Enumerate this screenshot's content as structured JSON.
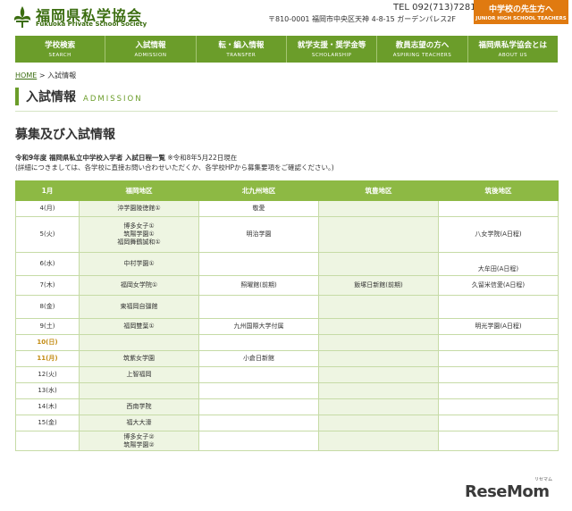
{
  "header": {
    "title": "福岡県私学協会",
    "subtitle": "Fukuoka Private School Society",
    "tel": "TEL 092(713)7281",
    "address": "〒810-0001 福岡市中央区天神 4-8-15 ガーデンパレス2F",
    "teacher_button": {
      "label": "中学校の先生方へ",
      "sub": "JUNIOR HIGH SCHOOL TEACHERS"
    },
    "brand_color": "#6b9d2a"
  },
  "nav": [
    {
      "ja": "学校検索",
      "en": "SEARCH"
    },
    {
      "ja": "入試情報",
      "en": "ADMISSION"
    },
    {
      "ja": "転・編入情報",
      "en": "TRANSFER"
    },
    {
      "ja": "就学支援・奨学金等",
      "en": "SCHOLARSHIP"
    },
    {
      "ja": "教員志望の方へ",
      "en": "ASPIRING TEACHERS"
    },
    {
      "ja": "福岡県私学協会とは",
      "en": "ABOUT US"
    }
  ],
  "breadcrumb": {
    "home": "HOME",
    "sep": " > ",
    "current": "入試情報"
  },
  "page": {
    "title": "入試情報",
    "title_en": "ADMISSION",
    "section_title": "募集及び入試情報"
  },
  "schedule": {
    "list_title": "令和9年度 福岡県私立中学校入学者 入試日程一覧",
    "list_date": "※令和8年5月22日現在",
    "note": "(詳細につきましては、各学校に直接お問い合わせいただくか、各学校HPから募集要項をご確認ください。)",
    "headers": [
      "1月",
      "福岡地区",
      "北九州地区",
      "筑豊地区",
      "筑後地区"
    ],
    "rows": [
      {
        "date": "4(月)",
        "fukuoka": "沖学園陵徳館①",
        "kitakyushu": "敬愛",
        "chikuho": "",
        "chikugo": ""
      },
      {
        "date": "5(火)",
        "fukuoka": "博多女子①\n筑陽学園①\n福岡舞鶴誠和①",
        "kitakyushu": "明治学園",
        "chikuho": "",
        "chikugo": "八女学院(A日程)"
      },
      {
        "date": "6(水)",
        "fukuoka": "中村学園①",
        "kitakyushu": "",
        "chikuho": "",
        "chikugo": "大牟田(A日程)"
      },
      {
        "date": "7(木)",
        "fukuoka": "福岡女学院①",
        "kitakyushu": "照曜館(前期)",
        "chikuho": "飯塚日新館(前期)",
        "chikugo": "久留米信愛(A日程)"
      },
      {
        "date": "8(金)",
        "fukuoka": "東福岡自彊館",
        "kitakyushu": "",
        "chikuho": "",
        "chikugo": ""
      },
      {
        "date": "9(土)",
        "fukuoka": "福岡雙葉①",
        "kitakyushu": "九州国際大学付属",
        "chikuho": "",
        "chikugo": "明光学園(A日程)"
      },
      {
        "date": "10(日)",
        "fukuoka": "",
        "kitakyushu": "",
        "chikuho": "",
        "chikugo": "",
        "holiday": true
      },
      {
        "date": "11(月)",
        "fukuoka": "筑紫女学園",
        "kitakyushu": "小倉日新館",
        "chikuho": "",
        "chikugo": "",
        "holiday": true
      },
      {
        "date": "12(火)",
        "fukuoka": "上智福岡",
        "kitakyushu": "",
        "chikuho": "",
        "chikugo": ""
      },
      {
        "date": "13(水)",
        "fukuoka": "",
        "kitakyushu": "",
        "chikuho": "",
        "chikugo": ""
      },
      {
        "date": "14(木)",
        "fukuoka": "西南学院",
        "kitakyushu": "",
        "chikuho": "",
        "chikugo": ""
      },
      {
        "date": "15(金)",
        "fukuoka": "福大大濠",
        "kitakyushu": "",
        "chikuho": "",
        "chikugo": ""
      },
      {
        "date": "",
        "fukuoka": "博多女子②\n筑陽学園②",
        "kitakyushu": "",
        "chikuho": "",
        "chikugo": ""
      }
    ]
  },
  "watermark": {
    "text": "ReseMom",
    "sub": "リセマム"
  }
}
